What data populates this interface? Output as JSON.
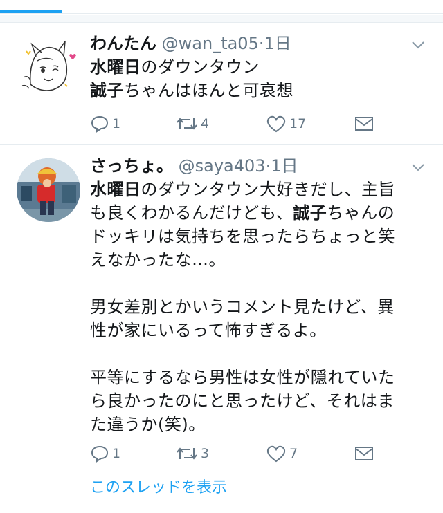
{
  "tweets": [
    {
      "name": "わんたん",
      "handle": "@wan_ta05",
      "time": "1日",
      "lines": [
        [
          {
            "b": "水曜日"
          },
          {
            "t": "のダウンタウン"
          }
        ],
        [
          {
            "b": "誠子"
          },
          {
            "t": "ちゃんはほんと可哀想"
          }
        ]
      ],
      "stats": {
        "replies": "1",
        "retweets": "4",
        "likes": "17"
      }
    },
    {
      "name": "さっちょ。",
      "handle": "@saya403",
      "time": "1日",
      "lines": [
        [
          {
            "b": "水曜日"
          },
          {
            "t": "のダウンタウン大好きだし、主旨"
          }
        ],
        [
          {
            "t": "も良くわかるんだけども、"
          },
          {
            "b": "誠子"
          },
          {
            "t": "ちゃんの"
          }
        ],
        [
          {
            "t": "ドッキリは気持ちを思ったらちょっと笑"
          }
        ],
        [
          {
            "t": "えなかったな…。"
          }
        ],
        [],
        [
          {
            "t": "男女差別とかいうコメント見たけど、異"
          }
        ],
        [
          {
            "t": "性が家にいるって怖すぎるよ。"
          }
        ],
        [],
        [
          {
            "t": "平等にするなら男性は女性が隠れていた"
          }
        ],
        [
          {
            "t": "ら良かったのにと思ったけど、それはま"
          }
        ],
        [
          {
            "t": "た違うか(笑)。"
          }
        ]
      ],
      "stats": {
        "replies": "1",
        "retweets": "3",
        "likes": "7"
      },
      "thread_link": "このスレッドを表示"
    }
  ],
  "icons": {
    "reply": "reply-icon",
    "retweet": "retweet-icon",
    "like": "heart-icon",
    "dm": "envelope-icon",
    "more": "chevron-down-icon"
  },
  "colors": {
    "accent": "#1da1f2",
    "muted": "#657786",
    "text": "#14171a",
    "divider": "#e6ecf0"
  }
}
